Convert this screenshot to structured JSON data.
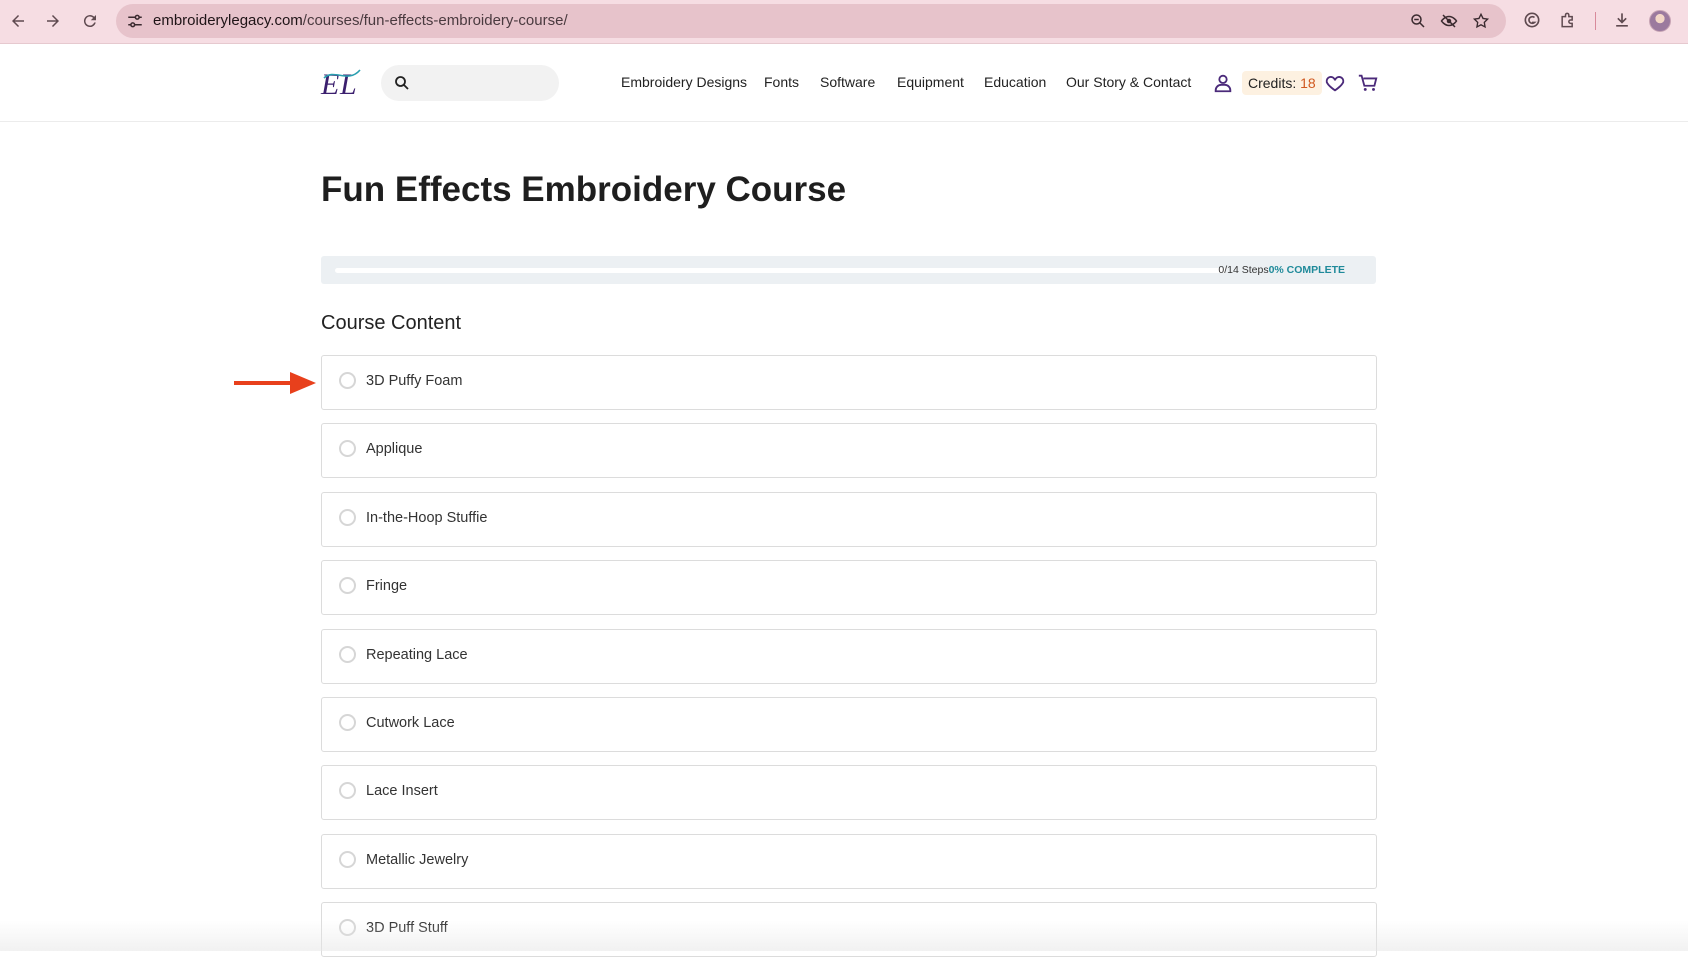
{
  "browser": {
    "url_host": "embroiderylegacy.com",
    "url_path": "/courses/fun-effects-embroidery-course/"
  },
  "site": {
    "search": {
      "placeholder": ""
    },
    "nav": [
      "Embroidery Designs",
      "Fonts",
      "Software",
      "Equipment",
      "Education",
      "Our Story & Contact"
    ],
    "credits_label": "Credits:",
    "credits_value": "18"
  },
  "course": {
    "title": "Fun Effects Embroidery Course",
    "progress": {
      "steps_text": "0/14 Steps",
      "percent_text": "0% COMPLETE",
      "fraction": 0
    },
    "content_heading": "Course Content",
    "lessons": [
      "3D Puffy Foam",
      "Applique",
      "In-the-Hoop Stuffie",
      "Fringe",
      "Repeating Lace",
      "Cutwork Lace",
      "Lace Insert",
      "Metallic Jewelry",
      "3D Puff Stuff"
    ]
  },
  "colors": {
    "brand_purple": "#4b2a7a",
    "accent_teal": "#1f8a9a",
    "annotation_arrow": "#e8401c",
    "chrome_bg": "#f6dde3"
  }
}
